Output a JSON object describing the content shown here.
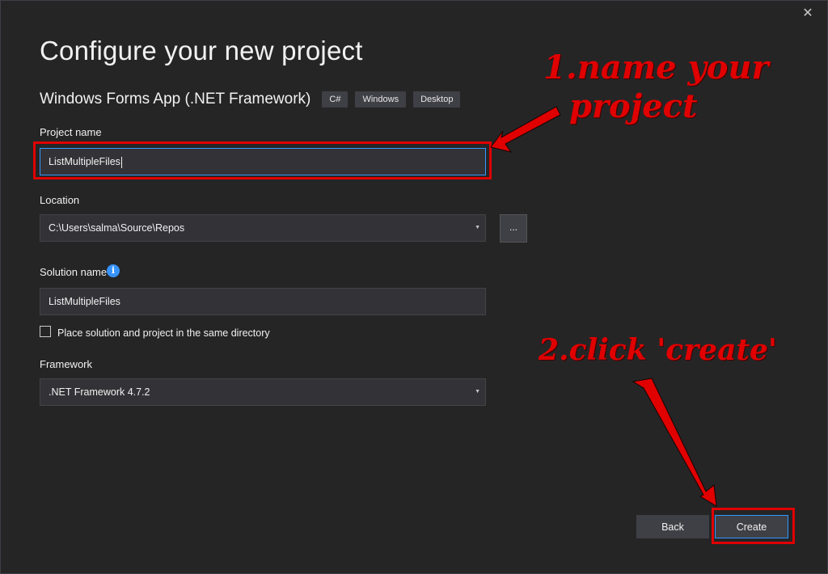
{
  "window": {
    "title": "Configure your new project",
    "close_glyph": "✕"
  },
  "template": {
    "name": "Windows Forms App (.NET Framework)",
    "tags": [
      "C#",
      "Windows",
      "Desktop"
    ]
  },
  "form": {
    "project_name_label": "Project name",
    "project_name_value": "ListMultipleFiles",
    "location_label": "Location",
    "location_value": "C:\\Users\\salma\\Source\\Repos",
    "browse_label": "...",
    "solution_name_label": "Solution name",
    "info_glyph": "i",
    "solution_name_value": "ListMultipleFiles",
    "same_dir_label": "Place solution and project in the same directory",
    "same_dir_checked": false,
    "framework_label": "Framework",
    "framework_value": ".NET Framework 4.7.2"
  },
  "buttons": {
    "back_label": "Back",
    "create_label": "Create"
  },
  "annotations": {
    "step1_line1": "1.name your",
    "step1_line2": "project",
    "step2": "2.click 'create'",
    "color": "#e00000"
  },
  "icons": {
    "close": "close-icon",
    "dropdown": "chevron-down-icon",
    "info": "info-icon"
  }
}
